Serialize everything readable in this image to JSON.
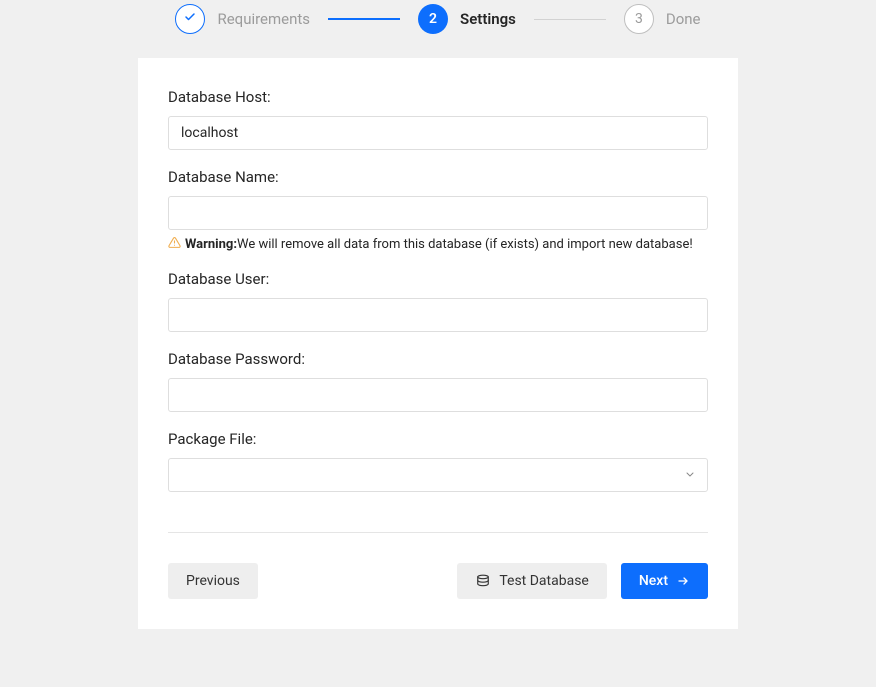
{
  "stepper": {
    "steps": [
      {
        "label": "Requirements"
      },
      {
        "label": "Settings",
        "number": "2"
      },
      {
        "label": "Done",
        "number": "3"
      }
    ]
  },
  "form": {
    "db_host": {
      "label": "Database Host:",
      "value": "localhost"
    },
    "db_name": {
      "label": "Database Name:",
      "value": "",
      "warning_prefix": "Warning:",
      "warning_text": "We will remove all data from this database (if exists) and import new database!"
    },
    "db_user": {
      "label": "Database User:",
      "value": ""
    },
    "db_password": {
      "label": "Database Password:",
      "value": ""
    },
    "package_file": {
      "label": "Package File:",
      "selected": ""
    }
  },
  "footer": {
    "previous": "Previous",
    "test_database": "Test Database",
    "next": "Next"
  }
}
